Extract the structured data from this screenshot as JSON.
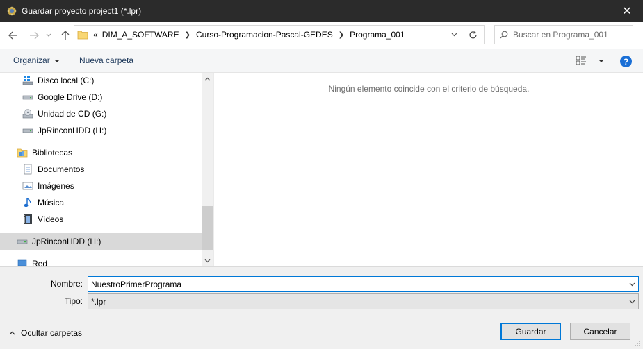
{
  "window": {
    "title": "Guardar proyecto project1 (*.lpr)",
    "close_glyph": "✕"
  },
  "address": {
    "overflow": "«",
    "crumbs": [
      "DIM_A_SOFTWARE",
      "Curso-Programacion-Pascal-GEDES",
      "Programa_001"
    ],
    "search_placeholder": "Buscar en Programa_001"
  },
  "toolbar": {
    "organizar": "Organizar",
    "nueva_carpeta": "Nueva carpeta",
    "help": "?"
  },
  "nav": {
    "items": [
      {
        "label": "Disco local (C:)",
        "icon": "windows-drive-icon"
      },
      {
        "label": "Google Drive (D:)",
        "icon": "drive-icon"
      },
      {
        "label": "Unidad de CD (G:)",
        "icon": "cd-drive-icon"
      },
      {
        "label": "JpRinconHDD (H:)",
        "icon": "drive-icon"
      },
      {
        "label": "Bibliotecas",
        "icon": "libraries-icon"
      },
      {
        "label": "Documentos",
        "icon": "documents-icon"
      },
      {
        "label": "Imágenes",
        "icon": "pictures-icon"
      },
      {
        "label": "Música",
        "icon": "music-icon"
      },
      {
        "label": "Vídeos",
        "icon": "videos-icon"
      },
      {
        "label": "JpRinconHDD (H:)",
        "icon": "drive-icon",
        "selected": true
      },
      {
        "label": "Red",
        "icon": "network-icon"
      }
    ]
  },
  "content": {
    "empty_message": "Ningún elemento coincide con el criterio de búsqueda."
  },
  "form": {
    "name_label": "Nombre:",
    "name_value": "NuestroPrimerPrograma",
    "type_label": "Tipo:",
    "type_value": "*.lpr",
    "hide_folders": "Ocultar carpetas",
    "save": "Guardar",
    "cancel": "Cancelar"
  },
  "colors": {
    "titlebar": "#2b2b2b",
    "accent": "#0078d7",
    "selected_row": "#d9d9d9"
  }
}
